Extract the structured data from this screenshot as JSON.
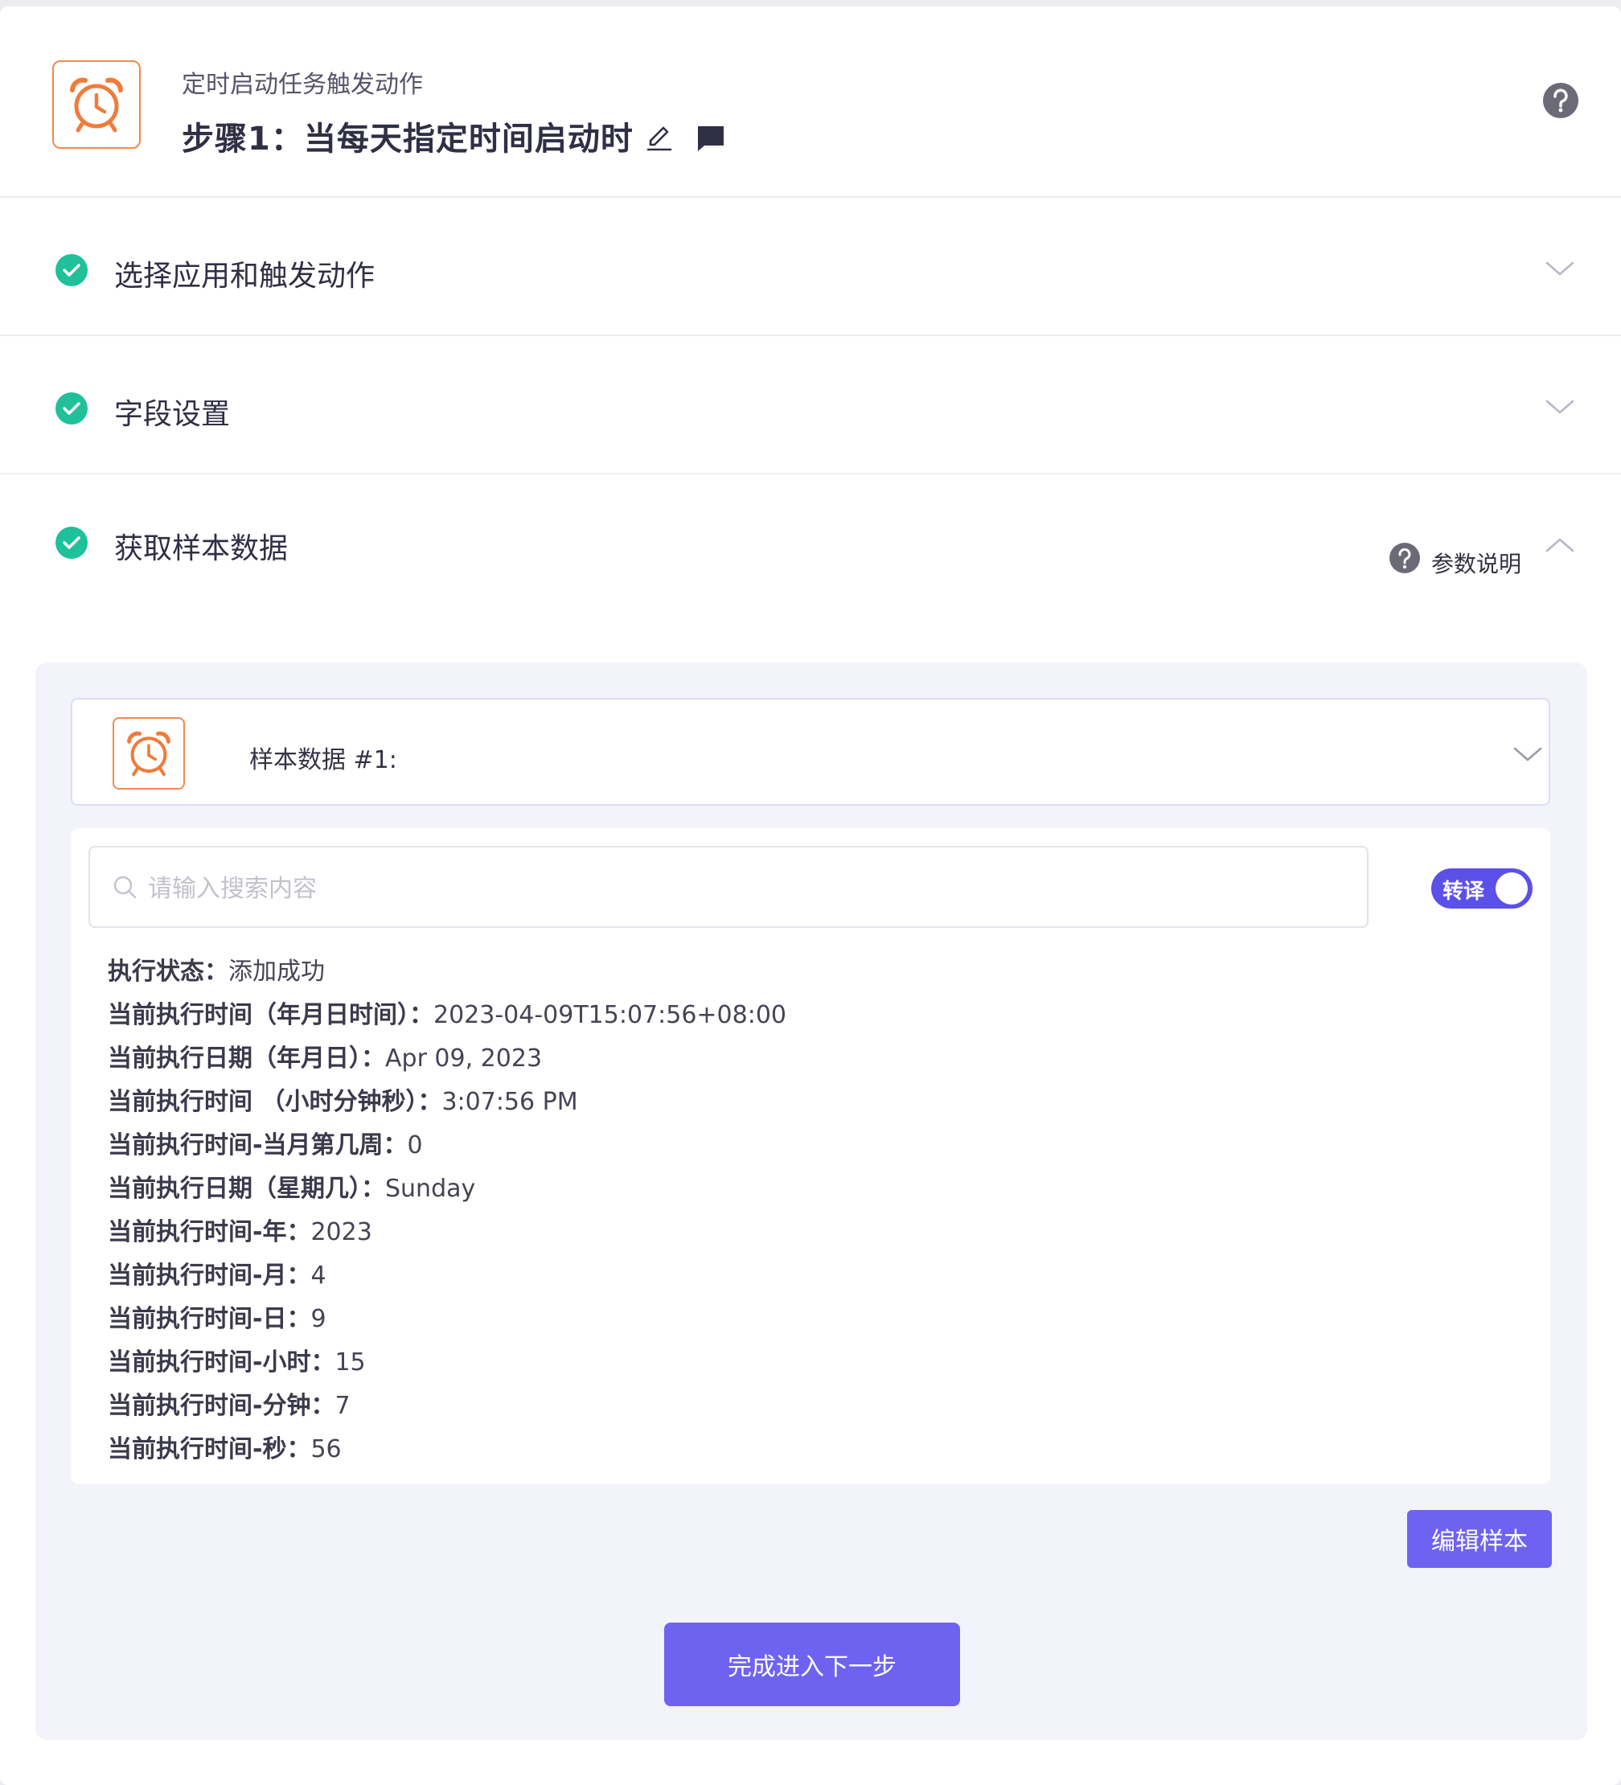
{
  "header": {
    "subtitle": "定时启动任务触发动作",
    "step_title": "步骤1：当每天指定时间启动时"
  },
  "sections": [
    {
      "label": "选择应用和触发动作",
      "status": "complete",
      "expanded": false
    },
    {
      "label": "字段设置",
      "status": "complete",
      "expanded": false
    },
    {
      "label": "获取样本数据",
      "status": "complete",
      "expanded": true
    }
  ],
  "param_help_label": "参数说明",
  "sample": {
    "card_label": "样本数据 #1:",
    "search_placeholder": "请输入搜索内容",
    "toggle_label": "转译",
    "toggle_on": true,
    "rows": [
      {
        "key": "执行状态：",
        "value": "添加成功"
      },
      {
        "key": "当前执行时间（年月日时间）：",
        "value": "2023-04-09T15:07:56+08:00"
      },
      {
        "key": "当前执行日期（年月日）：",
        "value": "Apr 09, 2023"
      },
      {
        "key": "当前执行时间 （小时分钟秒）：",
        "value": "3:07:56 PM"
      },
      {
        "key": "当前执行时间-当月第几周：",
        "value": "0"
      },
      {
        "key": "当前执行日期（星期几）：",
        "value": "Sunday"
      },
      {
        "key": "当前执行时间-年：",
        "value": "2023"
      },
      {
        "key": "当前执行时间-月：",
        "value": "4"
      },
      {
        "key": "当前执行时间-日：",
        "value": "9"
      },
      {
        "key": "当前执行时间-小时：",
        "value": "15"
      },
      {
        "key": "当前执行时间-分钟：",
        "value": "7"
      },
      {
        "key": "当前执行时间-秒：",
        "value": "56"
      }
    ]
  },
  "buttons": {
    "edit_sample": "编辑样本",
    "next_step": "完成进入下一步"
  },
  "colors": {
    "accent": "#6e63f0",
    "success": "#1fc09a",
    "logo_orange": "#f07b3a"
  }
}
